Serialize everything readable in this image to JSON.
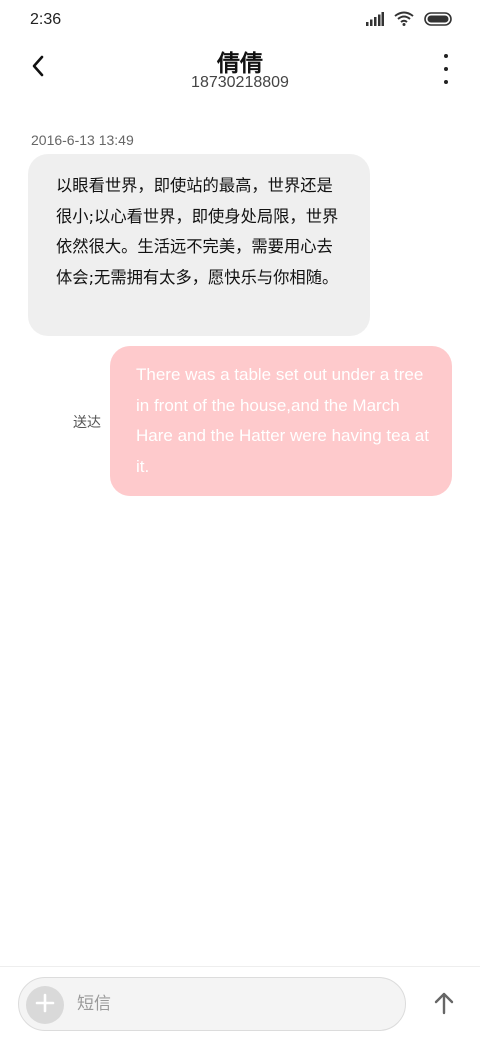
{
  "status_bar": {
    "time": "2:36",
    "icons": [
      "signal-icon",
      "wifi-icon",
      "battery-icon"
    ]
  },
  "header": {
    "back_icon": "chevron-left-icon",
    "contact_name": "倩倩",
    "contact_number": "18730218809",
    "more_icon": "more-vertical-icon"
  },
  "conversation": {
    "timestamp": "2016-6-13 13:49",
    "incoming_message": "以眼看世界，即使站的最高，世界还是很小;以心看世界，即使身处局限，世界依然很大。生活远不完美，需要用心去体会;无需拥有太多，愿快乐与你相随。",
    "outgoing_message": "There was a table set out under a tree in front of the house,and the March Hare and the Hatter were having tea at it.",
    "outgoing_status": "送达"
  },
  "composer": {
    "add_icon": "plus-icon",
    "placeholder": "短信",
    "value": "",
    "send_icon": "arrow-up-icon"
  },
  "colors": {
    "incoming_bubble": "#efefef",
    "outgoing_bubble": "#fecacc",
    "outgoing_text": "#ffffff"
  }
}
